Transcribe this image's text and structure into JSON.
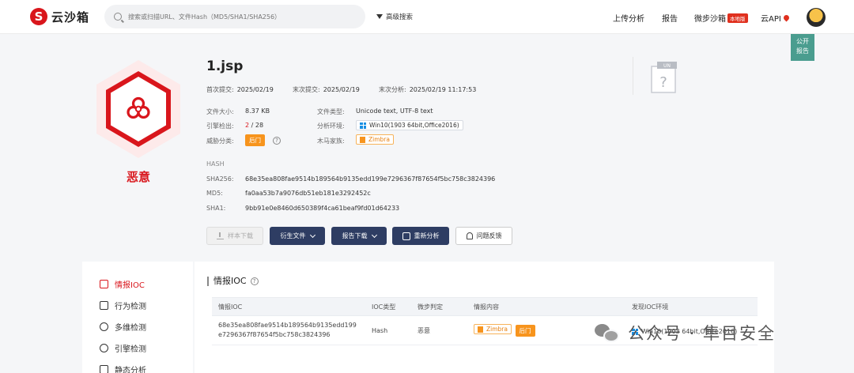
{
  "nav": {
    "logo_text": "云沙箱",
    "logo_mark": "S",
    "search_placeholder": "搜索或扫描URL、文件Hash（MD5/SHA1/SHA256）",
    "advanced_search": "高级搜索",
    "upload_analysis": "上传分析",
    "report": "报告",
    "micro_sandbox": "微步沙箱",
    "local_badge": "本地版",
    "cloud_api": "云API"
  },
  "public_report": [
    "公开",
    "报告"
  ],
  "verdict": "恶意",
  "file": {
    "name": "1.jsp",
    "first_submit_label": "首次提交:",
    "first_submit": "2025/02/19",
    "last_submit_label": "末次提交:",
    "last_submit": "2025/02/19",
    "last_analysis_label": "末次分析:",
    "last_analysis": "2025/02/19 11:17:53",
    "size_label": "文件大小:",
    "size": "8.37 KB",
    "type_label": "文件类型:",
    "type": "Unicode text, UTF-8 text",
    "engine_label": "引擎检出:",
    "engine_detect": "2",
    "engine_total": " / 28",
    "env_label": "分析环境:",
    "env": "Win10(1903 64bit,Office2016)",
    "threat_label": "威胁分类:",
    "threat": "后门",
    "family_label": "木马家族:",
    "family": "Zimbra",
    "unknown_badge": "UN"
  },
  "hash": {
    "heading": "HASH",
    "sha256_label": "SHA256:",
    "sha256": "68e35ea808fae9514b189564b9135edd199e7296367f87654f5bc758c3824396",
    "md5_label": "MD5:",
    "md5": "fa0aa53b7a9076db51eb181e3292452c",
    "sha1_label": "SHA1:",
    "sha1": "9bb91e0e8460d650389f4ca61beaf9fd01d64233"
  },
  "actions": {
    "sample_download": "样本下载",
    "derived_files": "衍生文件",
    "report_download": "报告下载",
    "reanalyze": "重新分析",
    "feedback": "问题反馈"
  },
  "sidebar": {
    "items": [
      {
        "label": "情报IOC"
      },
      {
        "label": "行为检测"
      },
      {
        "label": "多维检测"
      },
      {
        "label": "引擎检测"
      },
      {
        "label": "静态分析"
      }
    ]
  },
  "ioc": {
    "title": "情报IOC",
    "columns": [
      "情报IOC",
      "IOC类型",
      "微步判定",
      "情报内容",
      "发现IOC环境"
    ],
    "row": {
      "ioc": "68e35ea808fae9514b189564b9135edd199e7296367f87654f5bc758c3824396",
      "type": "Hash",
      "verdict": "恶意",
      "family": "Zimbra",
      "threat": "后门",
      "env": "Win10(1903 64bit,Office2016)"
    }
  },
  "watermark": "公众号 · 隼目安全",
  "colors": {
    "malicious_red": "#d9161c",
    "tag_orange": "#f7941d",
    "button_navy": "#2e3d63",
    "public_report_teal": "#4a9d8f"
  }
}
